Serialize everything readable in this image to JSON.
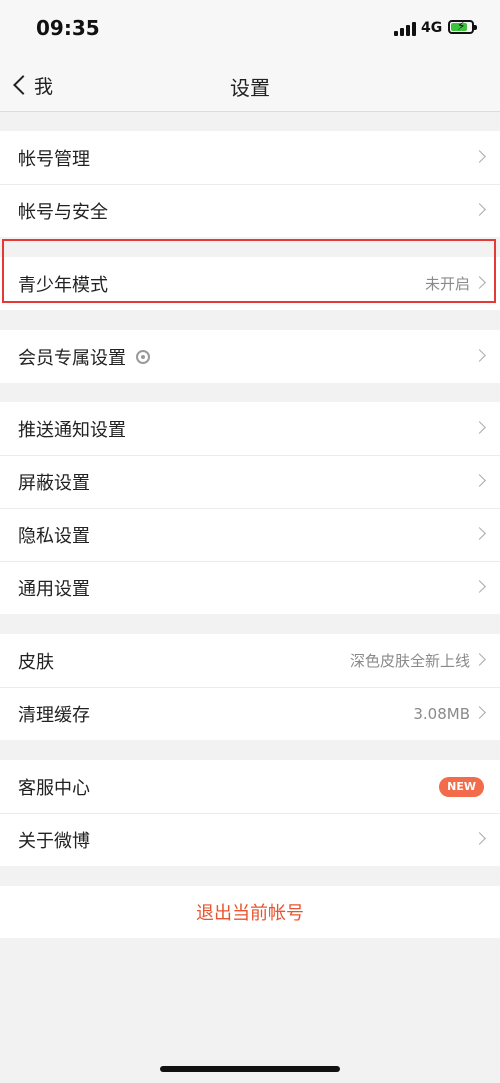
{
  "status_bar": {
    "time": "09:35",
    "network": "4G",
    "battery_icon": "battery-charging-icon"
  },
  "nav": {
    "back_label": "我",
    "title": "设置"
  },
  "groups": [
    {
      "items": [
        {
          "label": "帐号管理",
          "value": ""
        },
        {
          "label": "帐号与安全",
          "value": ""
        }
      ]
    },
    {
      "items": [
        {
          "label": "青少年模式",
          "value": "未开启",
          "highlighted": true
        }
      ]
    },
    {
      "items": [
        {
          "label": "会员专属设置",
          "value": "",
          "icon": "vip-crown-icon"
        }
      ]
    },
    {
      "items": [
        {
          "label": "推送通知设置",
          "value": ""
        },
        {
          "label": "屏蔽设置",
          "value": ""
        },
        {
          "label": "隐私设置",
          "value": ""
        },
        {
          "label": "通用设置",
          "value": ""
        }
      ]
    },
    {
      "items": [
        {
          "label": "皮肤",
          "value": "深色皮肤全新上线"
        },
        {
          "label": "清理缓存",
          "value": "3.08MB"
        }
      ]
    },
    {
      "items": [
        {
          "label": "客服中心",
          "value": "",
          "badge": "NEW"
        },
        {
          "label": "关于微博",
          "value": ""
        }
      ]
    }
  ],
  "logout_label": "退出当前帐号",
  "colors": {
    "accent": "#e8542f",
    "badge": "#f26b4a",
    "highlight_border": "#e53935",
    "background": "#f2f2f2"
  }
}
